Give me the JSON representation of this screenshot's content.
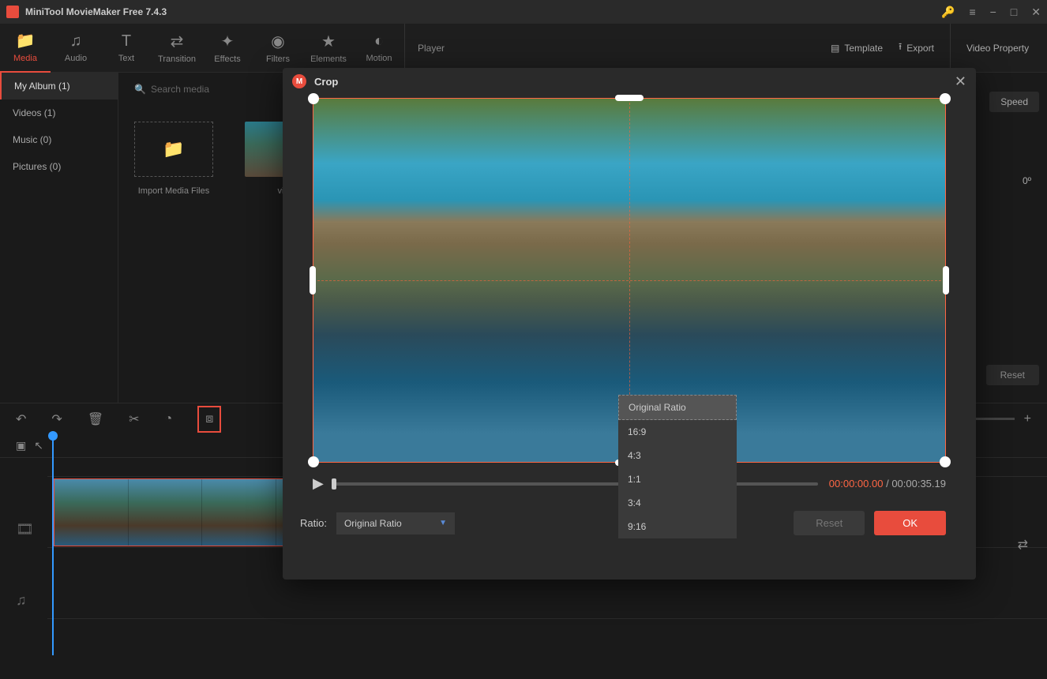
{
  "titlebar": {
    "title": "MiniTool MovieMaker Free 7.4.3"
  },
  "toolbar": {
    "items": [
      {
        "label": "Media"
      },
      {
        "label": "Audio"
      },
      {
        "label": "Text"
      },
      {
        "label": "Transition"
      },
      {
        "label": "Effects"
      },
      {
        "label": "Filters"
      },
      {
        "label": "Elements"
      },
      {
        "label": "Motion"
      }
    ],
    "player_label": "Player",
    "template_label": "Template",
    "export_label": "Export",
    "video_property_label": "Video Property"
  },
  "sidebar": {
    "items": [
      {
        "label": "My Album (1)"
      },
      {
        "label": "Videos (1)"
      },
      {
        "label": "Music (0)"
      },
      {
        "label": "Pictures (0)"
      }
    ]
  },
  "media": {
    "search_placeholder": "Search media",
    "import_label": "Import Media Files",
    "thumb_label": "vi..."
  },
  "right_panel": {
    "speed_label": "Speed",
    "rotate_value": "0º",
    "reset_label": "Reset"
  },
  "crop": {
    "title": "Crop",
    "time_current": "00:00:00.00",
    "time_total": "00:00:35.19",
    "ratio_label": "Ratio:",
    "ratio_selected": "Original Ratio",
    "ratio_options": [
      "Original Ratio",
      "16:9",
      "4:3",
      "1:1",
      "3:4",
      "9:16"
    ],
    "reset_label": "Reset",
    "ok_label": "OK"
  }
}
